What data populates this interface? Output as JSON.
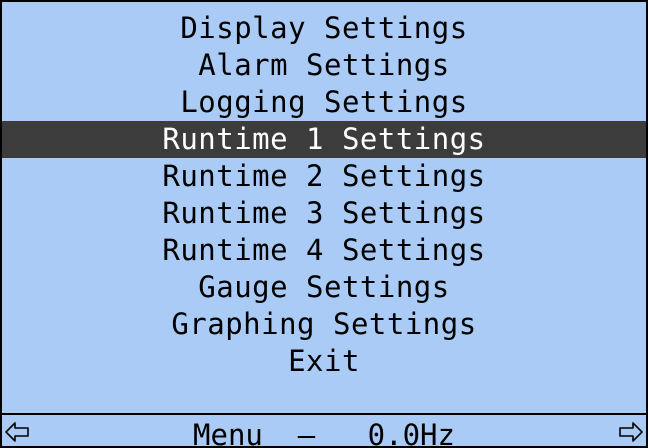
{
  "menu": {
    "items": [
      {
        "label": "Display Settings",
        "selected": false
      },
      {
        "label": "Alarm Settings",
        "selected": false
      },
      {
        "label": "Logging Settings",
        "selected": false
      },
      {
        "label": "Runtime 1 Settings",
        "selected": true
      },
      {
        "label": "Runtime 2 Settings",
        "selected": false
      },
      {
        "label": "Runtime 3 Settings",
        "selected": false
      },
      {
        "label": "Runtime 4 Settings",
        "selected": false
      },
      {
        "label": "Gauge Settings",
        "selected": false
      },
      {
        "label": "Graphing Settings",
        "selected": false
      },
      {
        "label": "Exit",
        "selected": false
      }
    ]
  },
  "status_bar": {
    "mode": "Menu",
    "separator": "–",
    "frequency": "0.0Hz",
    "left_icon": "arrow-left-icon",
    "right_icon": "arrow-right-icon"
  },
  "colors": {
    "background": "#a9cbf5",
    "selected_background": "#3c3c3c",
    "selected_text": "#ffffff",
    "text": "#000000"
  }
}
